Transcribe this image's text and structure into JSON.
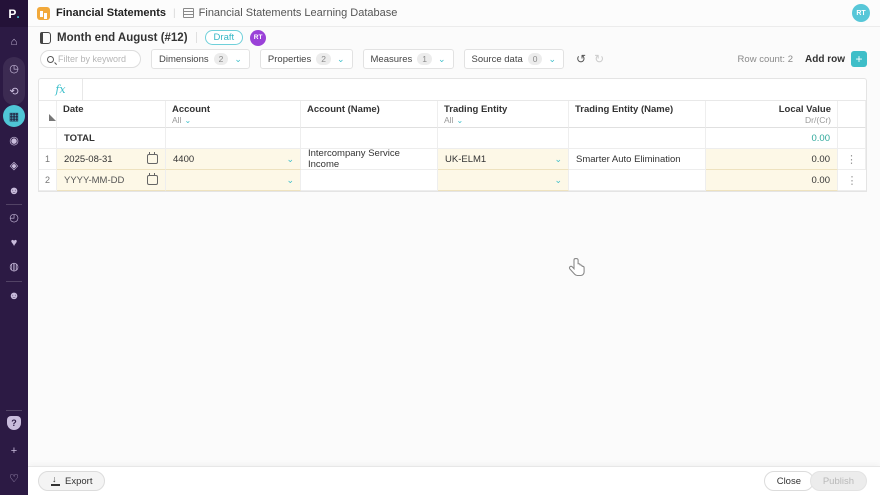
{
  "colors": {
    "accent_teal": "#3ebec8",
    "sidebar_bg": "#2c1a44",
    "cell_cream": "#fdf8e7",
    "total_value_teal": "#2fa89b",
    "draft_badge": "#35b6c5",
    "avatar_purple": "#9a41d8",
    "avatar_teal": "#57c7d8"
  },
  "topbar": {
    "logo_p": "P",
    "logo_dot": ".",
    "app_title": "Financial Statements",
    "separator": "|",
    "db_title": "Financial Statements Learning Database",
    "avatar": "RT"
  },
  "header": {
    "title": "Month end August (#12)",
    "status_badge": "Draft",
    "avatar": "RT"
  },
  "toolbar": {
    "search_placeholder": "Filter by keyword",
    "filters": [
      {
        "label": "Dimensions",
        "count": "2"
      },
      {
        "label": "Properties",
        "count": "2"
      },
      {
        "label": "Measures",
        "count": "1"
      },
      {
        "label": "Source data",
        "count": "0"
      }
    ],
    "undo": "↺",
    "redo": "↻",
    "row_count": "Row count: 2",
    "add_row": "Add row",
    "add_icon": "+"
  },
  "formula": {
    "fx": "fx"
  },
  "table": {
    "columns": [
      {
        "label": "Date",
        "sub": ""
      },
      {
        "label": "Account",
        "sub": "All"
      },
      {
        "label": "Account (Name)",
        "sub": ""
      },
      {
        "label": "Trading Entity",
        "sub": "All"
      },
      {
        "label": "Trading Entity (Name)",
        "sub": ""
      },
      {
        "label": "Local Value",
        "sub": "Dr/(Cr)"
      }
    ],
    "chev": "⌄",
    "total": {
      "label": "TOTAL",
      "value": "0.00"
    },
    "rows": [
      {
        "num": "1",
        "date": "2025-08-31",
        "account": "4400",
        "account_name": "Intercompany Service Income",
        "trading_entity": "UK-ELM1",
        "trading_entity_name": "Smarter Auto Elimination",
        "local_value": "0.00",
        "menu": "⋮"
      },
      {
        "num": "2",
        "date": "YYYY-MM-DD",
        "account": "",
        "account_name": "",
        "trading_entity": "",
        "trading_entity_name": "",
        "local_value": "0.00",
        "menu": "⋮"
      }
    ]
  },
  "sidebar_icons": {
    "home": "⌂",
    "activity": "◷",
    "flows": "⟲",
    "blocks": "▦",
    "explore": "◉",
    "tags": "◈",
    "member": "☻",
    "history": "◴",
    "favorites": "♥",
    "media": "◍",
    "community": "☻",
    "help": "?",
    "add": "+",
    "feedback": "♡"
  },
  "footer": {
    "export": "Export",
    "close": "Close",
    "publish": "Publish"
  }
}
